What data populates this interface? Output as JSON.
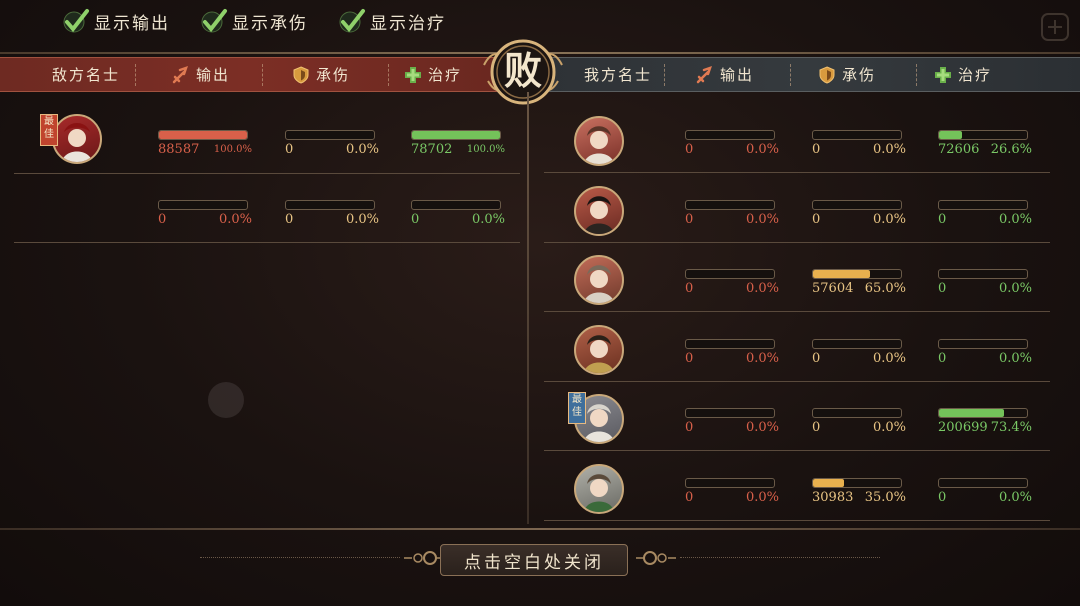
{
  "filters": [
    {
      "label": "显示输出",
      "checked": true
    },
    {
      "label": "显示承伤",
      "checked": true
    },
    {
      "label": "显示治疗",
      "checked": true
    }
  ],
  "result": "败",
  "enemy_header": {
    "name": "敌方名士",
    "output": "输出",
    "damage_taken": "承伤",
    "healing": "治疗"
  },
  "ally_header": {
    "name": "我方名士",
    "output": "输出",
    "damage_taken": "承伤",
    "healing": "治疗"
  },
  "best_badge": "最佳",
  "enemy_rows": [
    {
      "best": true,
      "output": {
        "value": "88587",
        "pct": "100.0%",
        "fill": 1.0
      },
      "taken": {
        "value": "0",
        "pct": "0.0%",
        "fill": 0
      },
      "heal": {
        "value": "78702",
        "pct": "100.0%",
        "fill": 1.0
      }
    },
    {
      "best": false,
      "output": {
        "value": "0",
        "pct": "0.0%",
        "fill": 0
      },
      "taken": {
        "value": "0",
        "pct": "0.0%",
        "fill": 0
      },
      "heal": {
        "value": "0",
        "pct": "0.0%",
        "fill": 0
      }
    }
  ],
  "ally_rows": [
    {
      "best": false,
      "output": {
        "value": "0",
        "pct": "0.0%",
        "fill": 0
      },
      "taken": {
        "value": "0",
        "pct": "0.0%",
        "fill": 0
      },
      "heal": {
        "value": "72606",
        "pct": "26.6%",
        "fill": 0.266
      }
    },
    {
      "best": false,
      "output": {
        "value": "0",
        "pct": "0.0%",
        "fill": 0
      },
      "taken": {
        "value": "0",
        "pct": "0.0%",
        "fill": 0
      },
      "heal": {
        "value": "0",
        "pct": "0.0%",
        "fill": 0
      }
    },
    {
      "best": false,
      "output": {
        "value": "0",
        "pct": "0.0%",
        "fill": 0
      },
      "taken": {
        "value": "57604",
        "pct": "65.0%",
        "fill": 0.65
      },
      "heal": {
        "value": "0",
        "pct": "0.0%",
        "fill": 0
      }
    },
    {
      "best": false,
      "output": {
        "value": "0",
        "pct": "0.0%",
        "fill": 0
      },
      "taken": {
        "value": "0",
        "pct": "0.0%",
        "fill": 0
      },
      "heal": {
        "value": "0",
        "pct": "0.0%",
        "fill": 0
      }
    },
    {
      "best": true,
      "output": {
        "value": "0",
        "pct": "0.0%",
        "fill": 0
      },
      "taken": {
        "value": "0",
        "pct": "0.0%",
        "fill": 0
      },
      "heal": {
        "value": "200699",
        "pct": "73.4%",
        "fill": 0.734
      }
    },
    {
      "best": false,
      "output": {
        "value": "0",
        "pct": "0.0%",
        "fill": 0
      },
      "taken": {
        "value": "30983",
        "pct": "35.0%",
        "fill": 0.35
      },
      "heal": {
        "value": "0",
        "pct": "0.0%",
        "fill": 0
      }
    }
  ],
  "close_hint": "点击空白处关闭",
  "colors": {
    "output": "#d8604a",
    "taken": "#e8b04e",
    "heal": "#74c25a"
  },
  "icons": {
    "check": "check-icon",
    "output": "sword-icon",
    "taken": "shield-icon",
    "heal": "cross-icon"
  }
}
